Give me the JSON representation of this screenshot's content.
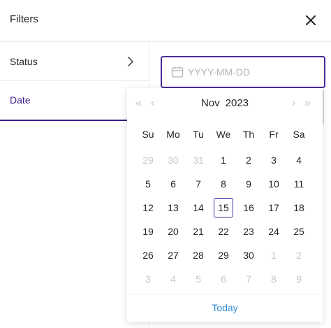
{
  "header": {
    "title": "Filters"
  },
  "sidebar": {
    "items": [
      {
        "label": "Status"
      },
      {
        "label": "Date"
      }
    ]
  },
  "date_input": {
    "placeholder": "YYYY-MM-DD",
    "value": ""
  },
  "calendar": {
    "month": "Nov",
    "year": "2023",
    "nav": {
      "prev_year": "«",
      "prev_month": "‹",
      "next_month": "›",
      "next_year": "»"
    },
    "weekdays": [
      "Su",
      "Mo",
      "Tu",
      "We",
      "Th",
      "Fr",
      "Sa"
    ],
    "weeks": [
      [
        {
          "d": "29",
          "m": true
        },
        {
          "d": "30",
          "m": true
        },
        {
          "d": "31",
          "m": true
        },
        {
          "d": "1"
        },
        {
          "d": "2"
        },
        {
          "d": "3"
        },
        {
          "d": "4"
        }
      ],
      [
        {
          "d": "5"
        },
        {
          "d": "6"
        },
        {
          "d": "7"
        },
        {
          "d": "8"
        },
        {
          "d": "9"
        },
        {
          "d": "10"
        },
        {
          "d": "11"
        }
      ],
      [
        {
          "d": "12"
        },
        {
          "d": "13"
        },
        {
          "d": "14"
        },
        {
          "d": "15",
          "today": true
        },
        {
          "d": "16"
        },
        {
          "d": "17"
        },
        {
          "d": "18"
        }
      ],
      [
        {
          "d": "19"
        },
        {
          "d": "20"
        },
        {
          "d": "21"
        },
        {
          "d": "22"
        },
        {
          "d": "23"
        },
        {
          "d": "24"
        },
        {
          "d": "25"
        }
      ],
      [
        {
          "d": "26"
        },
        {
          "d": "27"
        },
        {
          "d": "28"
        },
        {
          "d": "29"
        },
        {
          "d": "30"
        },
        {
          "d": "1",
          "m": true
        },
        {
          "d": "2",
          "m": true
        }
      ],
      [
        {
          "d": "3",
          "m": true
        },
        {
          "d": "4",
          "m": true
        },
        {
          "d": "5",
          "m": true
        },
        {
          "d": "6",
          "m": true
        },
        {
          "d": "7",
          "m": true
        },
        {
          "d": "8",
          "m": true
        },
        {
          "d": "9",
          "m": true
        }
      ]
    ],
    "today_label": "Today"
  },
  "colors": {
    "accent": "#3d1c8a",
    "link": "#2f8bd7",
    "muted_text": "#c7c7c7"
  },
  "icons": {
    "close": "close-icon",
    "chevron": "chevron-right-icon",
    "calendar": "calendar-icon"
  }
}
